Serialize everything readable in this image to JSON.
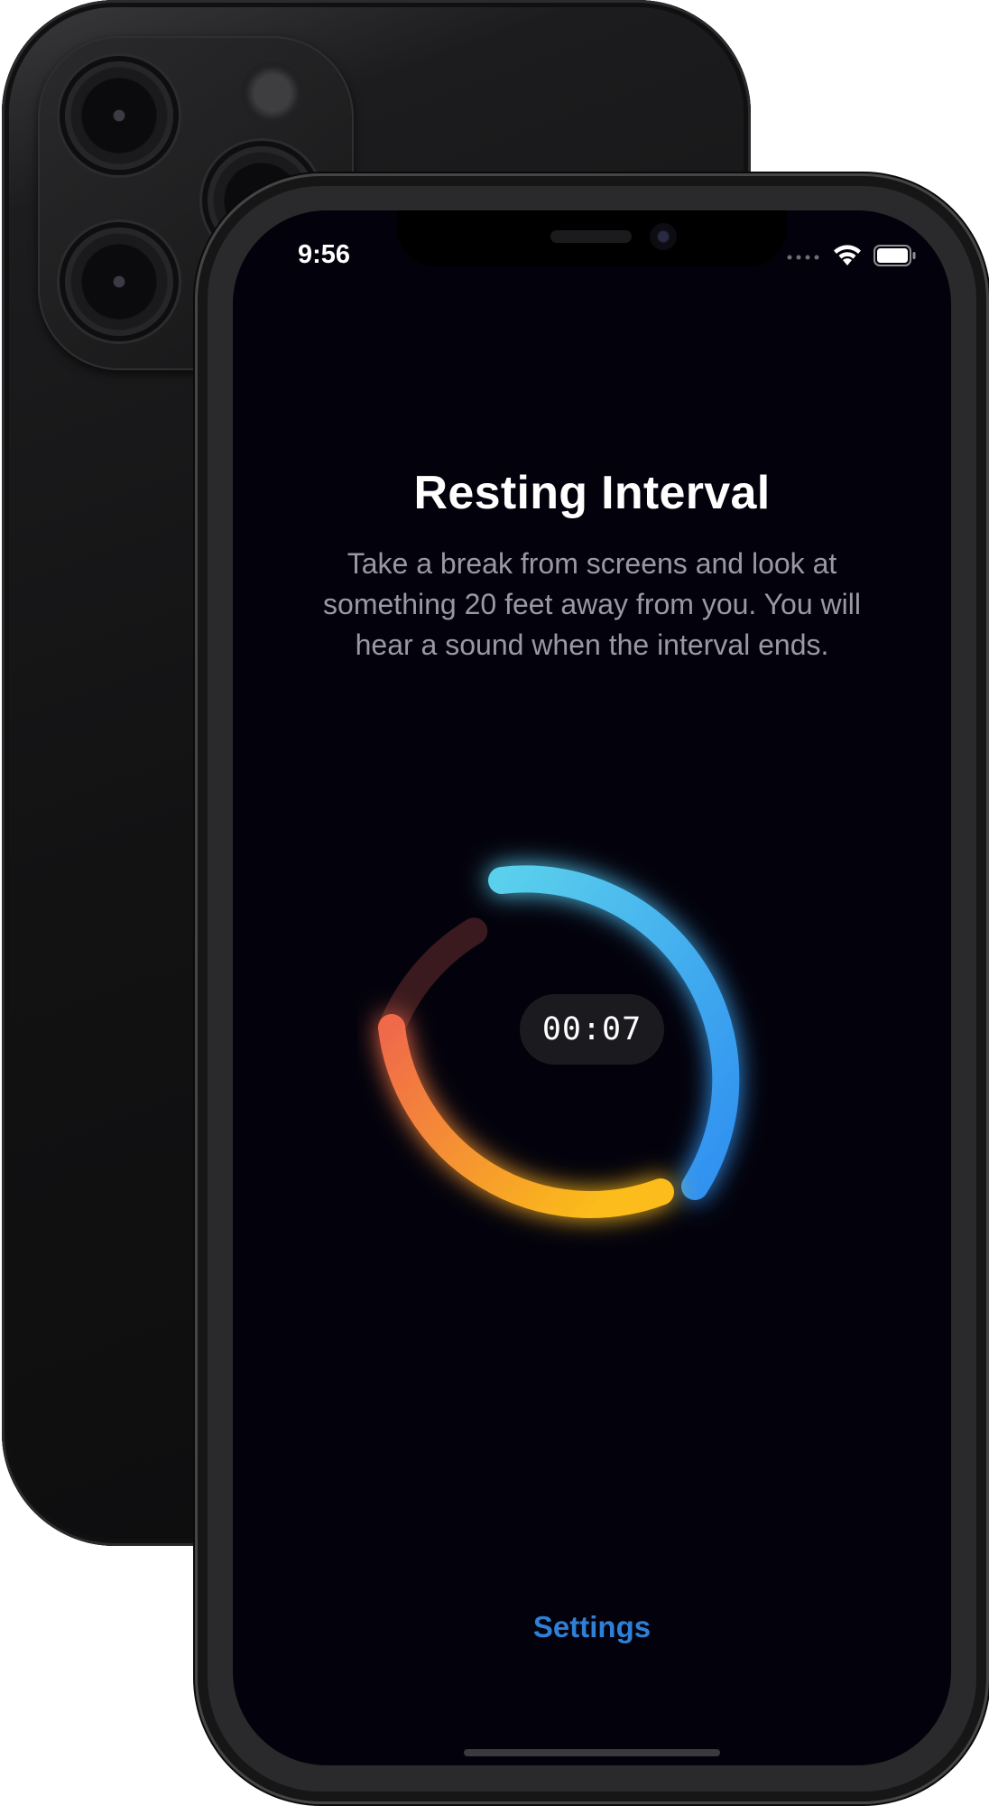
{
  "status_bar": {
    "time": "9:56"
  },
  "main": {
    "title": "Resting Interval",
    "description": "Take a break from screens and look at something 20 feet away from you. You will hear a sound when the interval ends.",
    "timer": "00:07"
  },
  "footer": {
    "settings_label": "Settings"
  },
  "colors": {
    "background": "#03020c",
    "link": "#2f7fd6",
    "ring_blue_start": "#5ad0ec",
    "ring_blue_end": "#2f8ff0",
    "ring_orange_start": "#f06a4a",
    "ring_orange_end": "#fbbc1a",
    "ring_track": "#3a1a1e"
  },
  "icons": [
    "wifi-icon",
    "battery-icon",
    "cellular-dots-icon"
  ]
}
